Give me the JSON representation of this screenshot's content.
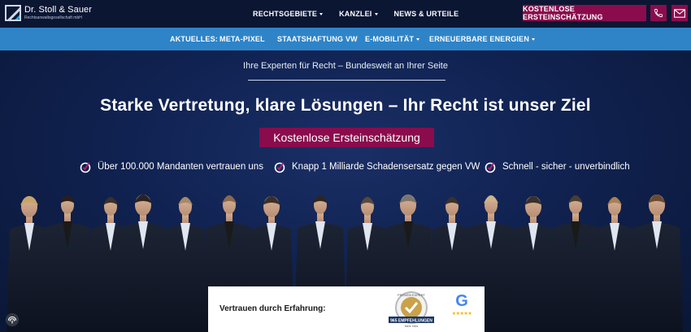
{
  "header": {
    "logo_name": "Dr. Stoll & Sauer",
    "logo_sub": "Rechtsanwaltsgesellschaft mbH",
    "nav": [
      {
        "label": "RECHTSGEBIETE",
        "dropdown": true
      },
      {
        "label": "KANZLEI",
        "dropdown": true
      },
      {
        "label": "NEWS & URTEILE",
        "dropdown": false
      }
    ],
    "cta_label": "KOSTENLOSE ERSTEINSCHÄTZUNG",
    "icons": [
      "phone-icon",
      "mail-icon"
    ]
  },
  "subnav": {
    "label": "AKTUELLES:",
    "items": [
      {
        "label": "META-PIXEL",
        "dropdown": false
      },
      {
        "label": "STAATSHAFTUNG VW",
        "dropdown": false
      },
      {
        "label": "E-MOBILITÄT",
        "dropdown": true
      },
      {
        "label": "ERNEUERBARE ENERGIEN",
        "dropdown": true
      }
    ]
  },
  "hero": {
    "tagline": "Ihre Experten für Recht – Bundesweit an Ihrer Seite",
    "headline": "Starke Vertretung, klare Lösungen – Ihr Recht ist unser Ziel",
    "cta_label": "Kostenlose Ersteinschätzung",
    "bullets": [
      "Über 100.000 Mandanten vertrauen uns",
      "Knapp 1 Milliarde Schadensersatz gegen VW",
      "Schnell - sicher - unverbindlich"
    ]
  },
  "trust": {
    "label": "Vertrauen durch Erfahrung:",
    "seal_top": "PROVEN EXPERT",
    "seal_ribbon": "965 EMPFEHLUNGEN",
    "seal_sub": "Mehr Infos",
    "google_letter": "G",
    "google_stars": "★★★★★"
  },
  "colors": {
    "header_bg": "#0b1633",
    "subnav_bg": "#2f84c8",
    "accent": "#8a0c4d",
    "hero_bg": "#102251"
  }
}
